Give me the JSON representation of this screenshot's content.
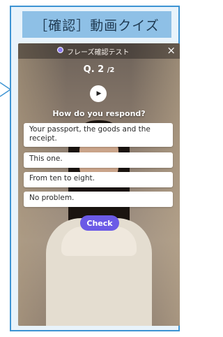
{
  "header": {
    "title": "［確認］動画クイズ"
  },
  "player": {
    "title": "フレーズ確認テスト",
    "close_icon": "×"
  },
  "question": {
    "label": "Q. 2",
    "total": "/2",
    "prompt": "How do you respond?"
  },
  "options": [
    {
      "text": "Your passport, the goods and the receipt."
    },
    {
      "text": "This one."
    },
    {
      "text": "From ten to eight."
    },
    {
      "text": "No problem."
    }
  ],
  "actions": {
    "check_label": "Check"
  },
  "colors": {
    "frame_border": "#3d94d3",
    "header_bg": "#8ec0e6",
    "check_button": "#6b5ae6"
  }
}
